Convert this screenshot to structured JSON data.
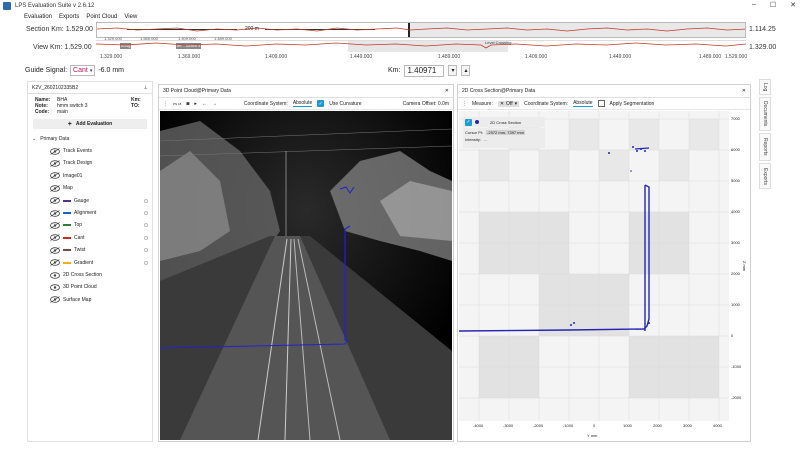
{
  "window": {
    "title": "LPS Evaluation Suite v 2.6.12",
    "minimize": "–",
    "maximize": "☐",
    "close": "✕"
  },
  "menu": [
    "Evaluation",
    "Exports",
    "Point Cloud",
    "View"
  ],
  "section_km": {
    "label": "Section Km:",
    "start": "1.529.00",
    "end": "1.114.25",
    "scale_label": "200 m"
  },
  "view_km": {
    "label": "View Km:",
    "start": "1.529.00",
    "end": "1.329.00",
    "flags": [
      "Bridg",
      "Im ...switch 3",
      "Level Crossing"
    ]
  },
  "km_axis": [
    "1.329.000",
    "1.369.000",
    "1.409.000",
    "1.449.000",
    "1.489.000",
    "1.409.000",
    "1.449.000",
    "1.489.000",
    "1.529.000"
  ],
  "km_axis_top": [
    "1.329.000",
    "1.569.000",
    "1.409.000",
    "1.489.000"
  ],
  "guide_signal": {
    "label": "Guide Signal:",
    "value": "Cant",
    "reading": "-6.0 mm"
  },
  "km_field": {
    "label": "Km:",
    "value": "1.40971"
  },
  "left_panel": {
    "file": "K2V_2602102335B2",
    "pin": "📌",
    "info": [
      {
        "k": "Name:",
        "v": "BHA",
        "k2": "Km:"
      },
      {
        "k": "Note:",
        "v": "hmm switch 3",
        "k2": "TO:"
      },
      {
        "k": "Code:",
        "v": "main",
        "k2": ""
      }
    ],
    "add_button": "Add Evaluation",
    "tree_root": "Primary Data",
    "items": [
      {
        "label": "Track Events",
        "swatch": "",
        "dot": false
      },
      {
        "label": "Track Design",
        "swatch": "",
        "dot": false
      },
      {
        "label": "Image01",
        "swatch": "",
        "dot": false
      },
      {
        "label": "Map",
        "swatch": "",
        "dot": false
      },
      {
        "label": "Gauge",
        "swatch": "#5a2d82",
        "dot": true
      },
      {
        "label": "Alignment",
        "swatch": "#1565c0",
        "dot": true
      },
      {
        "label": "Top",
        "swatch": "#2e7d32",
        "dot": true
      },
      {
        "label": "Cant",
        "swatch": "#c62828",
        "dot": true
      },
      {
        "label": "Twist",
        "swatch": "#6d4c41",
        "dot": true
      },
      {
        "label": "Gradient",
        "swatch": "#f9a825",
        "dot": true
      },
      {
        "label": "2D Cross Section",
        "swatch": "",
        "dot": false
      },
      {
        "label": "3D Point Cloud",
        "swatch": "",
        "dot": false
      },
      {
        "label": "Surface Map",
        "swatch": "",
        "dot": false
      }
    ]
  },
  "pc_panel": {
    "title": "3D Point Cloud@Primary Data",
    "close": "✕",
    "tb_values": [
      "PN 18"
    ],
    "coord_label": "Coordinate System:",
    "coord_value": "Absolute",
    "curvature_label": "Use Curvature",
    "camera_label": "Camera Offset: 0.0m"
  },
  "cs_panel": {
    "title": "2D Cross Section@Primary Data",
    "close": "✕",
    "measure_label": "Measure:",
    "measure_value": "Off",
    "coord_label": "Coordinate System:",
    "coord_value": "Absolute",
    "segmentation_label": "Apply Segmentation",
    "legend_label": "2D Cross Section",
    "cursor_label": "Cursor Pt:",
    "cursor_value": "-2972 mm, 7397 mm",
    "intensity_label": "Intensity:",
    "intensity_value": "...",
    "y_ticks": [
      "7000",
      "6000",
      "5000",
      "4000",
      "3000",
      "2000",
      "1000",
      "0",
      "-1000",
      "-2000"
    ],
    "x_ticks": [
      "-4000",
      "-3000",
      "-2000",
      "-1000",
      "0",
      "1000",
      "2000",
      "3000",
      "4000"
    ],
    "x_unit": "Y mm",
    "y_unit": "Z mm"
  },
  "right_tabs": [
    "Log",
    "Documents",
    "Reports",
    "Exports"
  ]
}
